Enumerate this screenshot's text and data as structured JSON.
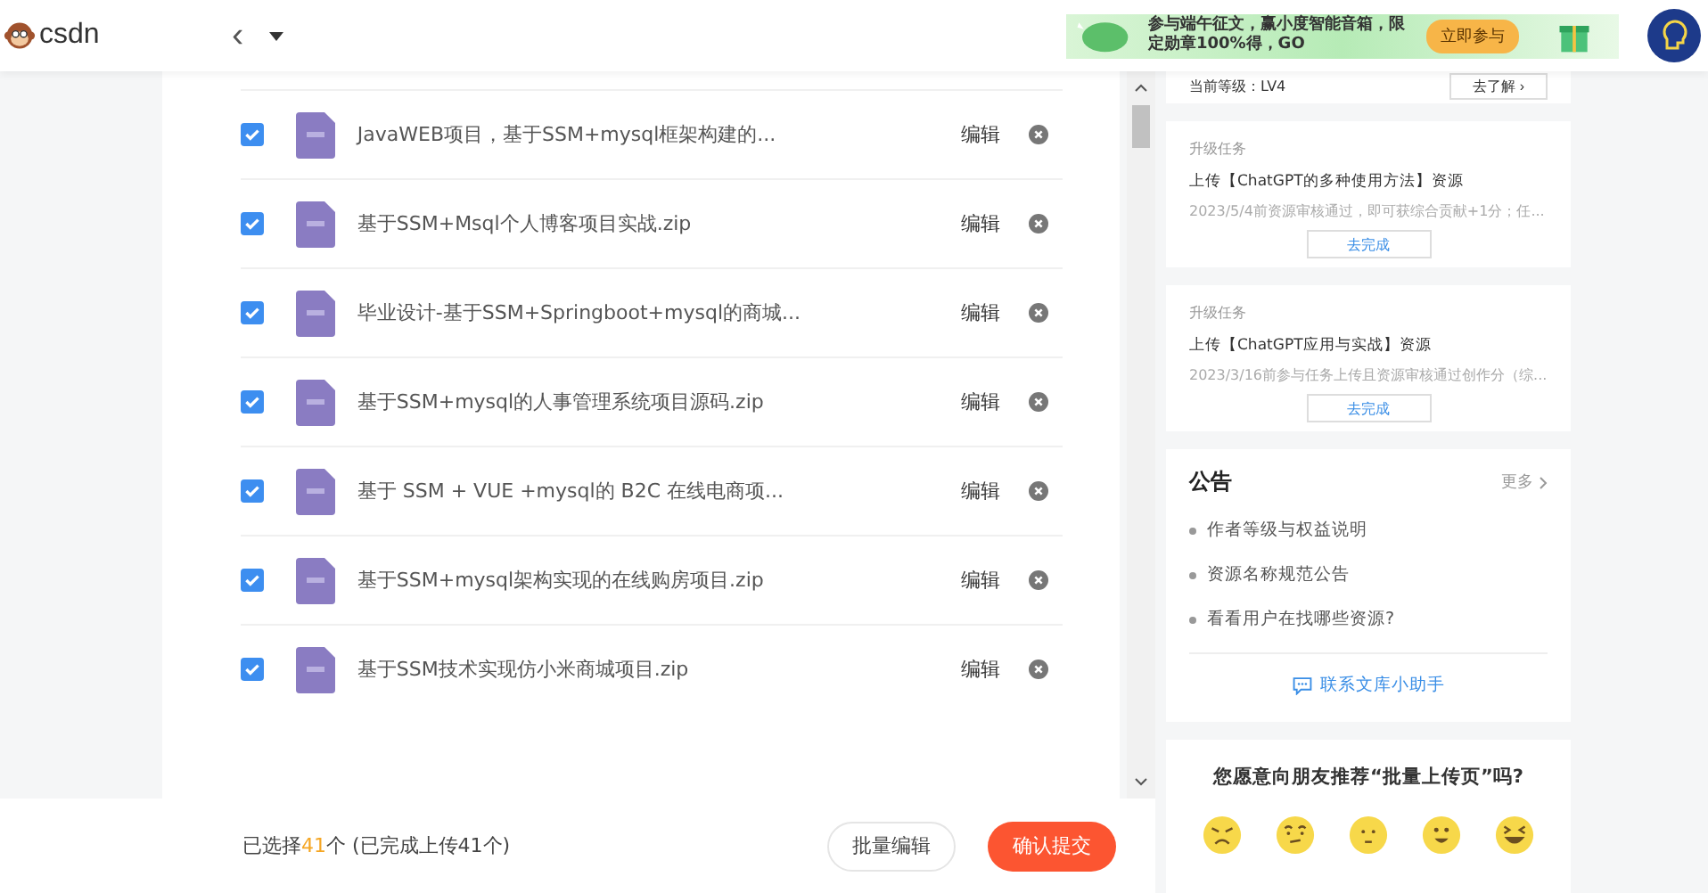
{
  "header": {
    "logo": "csdn",
    "back": "‹",
    "banner": {
      "text": "参与端午征文，赢小度智能音箱，限定勋章100%得，GO",
      "button": "立即参与"
    }
  },
  "files": [
    {
      "name": "JavaWEB项目，基于SSM+mysql框架构建的...",
      "checked": true,
      "edit": "编辑"
    },
    {
      "name": "基于SSM+Msql个人博客项目实战.zip",
      "checked": true,
      "edit": "编辑"
    },
    {
      "name": "毕业设计-基于SSM+Springboot+mysql的商城...",
      "checked": true,
      "edit": "编辑"
    },
    {
      "name": "基于SSM+mysql的人事管理系统项目源码.zip",
      "checked": true,
      "edit": "编辑"
    },
    {
      "name": "基于 SSM + VUE +mysql的 B2C 在线电商项...",
      "checked": true,
      "edit": "编辑"
    },
    {
      "name": "基于SSM+mysql架构实现的在线购房项目.zip",
      "checked": true,
      "edit": "编辑"
    },
    {
      "name": "基于SSM技术实现仿小米商城项目.zip",
      "checked": true,
      "edit": "编辑"
    }
  ],
  "footer": {
    "prefix": "已选择",
    "count": "41",
    "suffix": "个 (已完成上传41个)",
    "buttons": [
      {
        "label": "批量编辑",
        "kind": "outline"
      },
      {
        "label": "确认提交",
        "kind": "primary"
      }
    ]
  },
  "level_card": {
    "text": "当前等级：LV4",
    "button": "去了解 ›"
  },
  "tasks": [
    {
      "tag": "升级任务",
      "title": "上传【ChatGPT的多种使用方法】资源",
      "desc": "2023/5/4前资源审核通过，即可获综合贡献+1分；任...",
      "button": "去完成"
    },
    {
      "tag": "升级任务",
      "title": "上传【ChatGPT应用与实战】资源",
      "desc": "2023/3/16前参与任务上传且资源审核通过创作分（综...",
      "button": "去完成"
    }
  ],
  "notice": {
    "title": "公告",
    "more": "更多",
    "items": [
      "作者等级与权益说明",
      "资源名称规范公告",
      "看看用户在找哪些资源?"
    ],
    "contact": "联系文库小助手"
  },
  "survey": {
    "question": "您愿意向朋友推荐“批量上传页”吗?",
    "faces": [
      {
        "kind": "angry"
      },
      {
        "kind": "unsure"
      },
      {
        "kind": "neutral"
      },
      {
        "kind": "happy"
      },
      {
        "kind": "laugh"
      }
    ]
  }
}
